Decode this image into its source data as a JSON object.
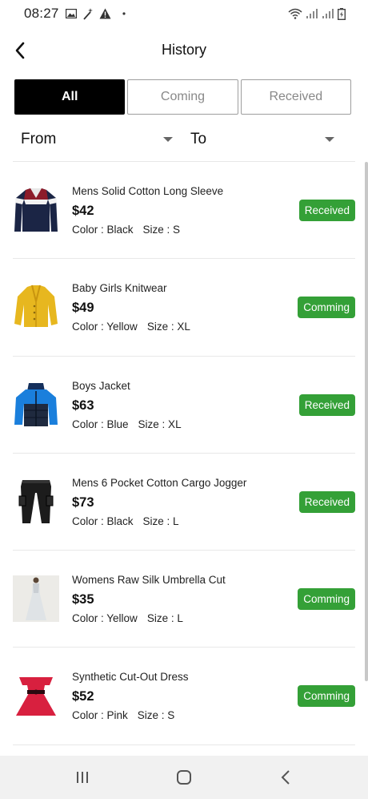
{
  "status_bar": {
    "time": "08:27",
    "left_icons": [
      "gallery-icon",
      "magic-wand-icon",
      "warning-icon",
      "dot-icon"
    ],
    "right_icons": [
      "wifi-icon",
      "signal-icon",
      "signal-icon",
      "battery-icon"
    ]
  },
  "header": {
    "title": "History",
    "back_icon": "chevron-left-icon"
  },
  "tabs": [
    {
      "label": "All",
      "active": true
    },
    {
      "label": "Coming",
      "active": false
    },
    {
      "label": "Received",
      "active": false
    }
  ],
  "filters": {
    "from_label": "From",
    "to_label": "To"
  },
  "items": [
    {
      "name": "Mens Solid Cotton Long Sleeve",
      "price": "$42",
      "color": "Color : Black",
      "size": "Size : S",
      "status": "Received",
      "status_color": "#34a037"
    },
    {
      "name": "Baby Girls Knitwear",
      "price": "$49",
      "color": "Color : Yellow",
      "size": "Size : XL",
      "status": "Comming",
      "status_color": "#34a037"
    },
    {
      "name": "Boys Jacket",
      "price": "$63",
      "color": "Color : Blue",
      "size": "Size : XL",
      "status": "Received",
      "status_color": "#34a037"
    },
    {
      "name": "Mens 6 Pocket Cotton Cargo Jogger",
      "price": "$73",
      "color": "Color : Black",
      "size": "Size : L",
      "status": "Received",
      "status_color": "#34a037"
    },
    {
      "name": "Womens Raw Silk Umbrella Cut",
      "price": "$35",
      "color": "Color : Yellow",
      "size": "Size : L",
      "status": "Comming",
      "status_color": "#34a037"
    },
    {
      "name": "Synthetic Cut-Out Dress",
      "price": "$52",
      "color": "Color : Pink",
      "size": "Size : S",
      "status": "Comming",
      "status_color": "#34a037"
    }
  ],
  "nav_bar": {
    "icons": [
      "recent-apps-icon",
      "home-icon",
      "back-icon"
    ]
  }
}
